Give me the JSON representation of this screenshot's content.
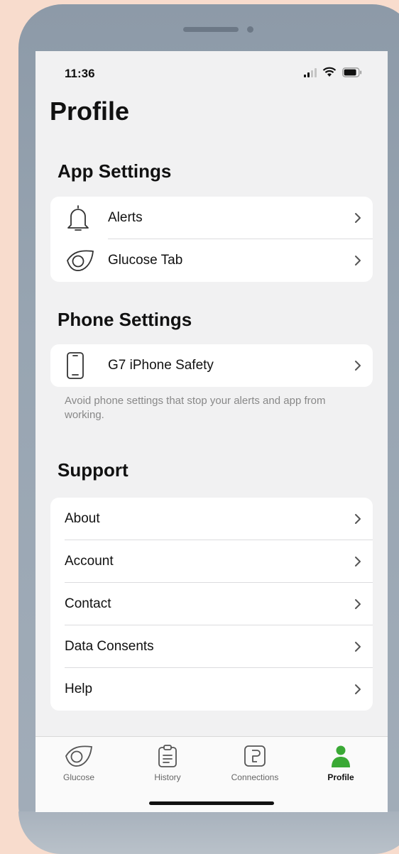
{
  "status_bar": {
    "time": "11:36"
  },
  "page": {
    "title": "Profile"
  },
  "app_settings": {
    "title": "App Settings",
    "items": [
      {
        "label": "Alerts",
        "icon": "bell-icon"
      },
      {
        "label": "Glucose Tab",
        "icon": "glucose-eye-icon"
      }
    ]
  },
  "phone_settings": {
    "title": "Phone Settings",
    "items": [
      {
        "label": "G7 iPhone Safety",
        "icon": "phone-icon"
      }
    ],
    "note": "Avoid phone settings that stop your alerts and app from working."
  },
  "support": {
    "title": "Support",
    "items": [
      {
        "label": "About"
      },
      {
        "label": "Account"
      },
      {
        "label": "Contact"
      },
      {
        "label": "Data Consents"
      },
      {
        "label": "Help"
      }
    ]
  },
  "tab_bar": {
    "tabs": [
      {
        "label": "Glucose",
        "icon": "glucose-eye-icon"
      },
      {
        "label": "History",
        "icon": "clipboard-icon"
      },
      {
        "label": "Connections",
        "icon": "connections-icon"
      },
      {
        "label": "Profile",
        "icon": "person-icon"
      }
    ],
    "active": "Profile",
    "active_color": "#3aa935"
  }
}
